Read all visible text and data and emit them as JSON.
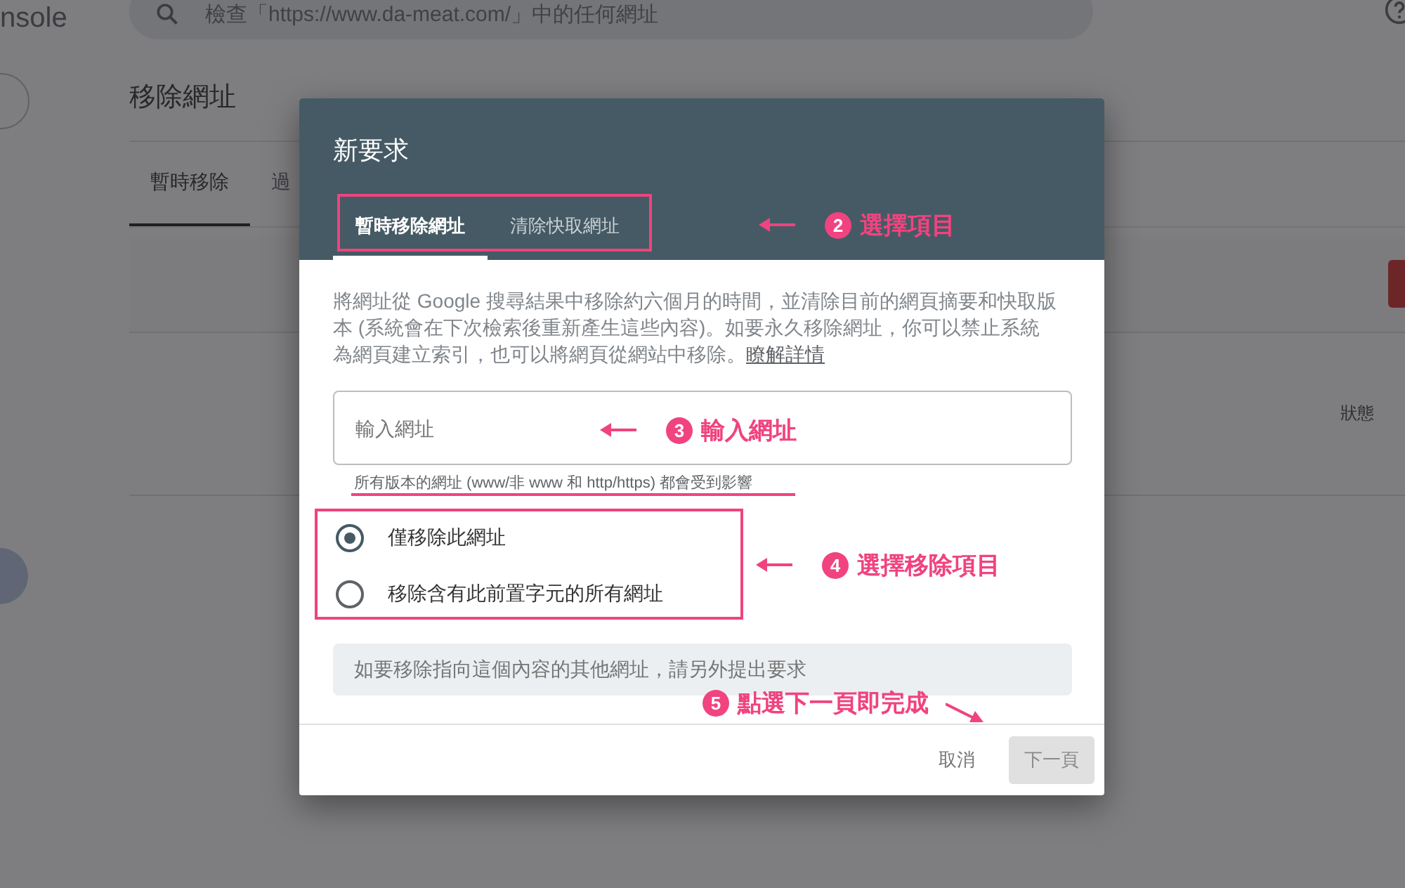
{
  "app": {
    "brand": "nsole",
    "search": {
      "placeholder": "檢查「https://www.da-meat.com/」中的任何網址"
    }
  },
  "page": {
    "title": "移除網址",
    "tabs": [
      {
        "label": "暫時移除",
        "selected": true
      },
      {
        "label": "過",
        "selected": false
      }
    ],
    "table_header": "狀態"
  },
  "dialog": {
    "title": "新要求",
    "tabs": [
      {
        "label": "暫時移除網址",
        "selected": true
      },
      {
        "label": "清除快取網址",
        "selected": false
      }
    ],
    "description": "將網址從 Google 搜尋結果中移除約六個月的時間，並清除目前的網頁摘要和快取版本 (系統會在下次檢索後重新產生這些內容)。如要永久移除網址，你可以禁止系統為網頁建立索引，也可以將網頁從網站中移除。",
    "learn_more": "瞭解詳情",
    "url_field": {
      "placeholder": "輸入網址"
    },
    "helper": "所有版本的網址 (www/非 www 和 http/https) 都會受到影響",
    "options": [
      {
        "label": "僅移除此網址",
        "selected": true
      },
      {
        "label": "移除含有此前置字元的所有網址",
        "selected": false
      }
    ],
    "notice": "如要移除指向這個內容的其他網址，請另外提出要求",
    "buttons": [
      {
        "label": "取消",
        "kind": "text",
        "disabled": false
      },
      {
        "label": "下一頁",
        "kind": "filled",
        "disabled": true
      }
    ]
  },
  "annotations": [
    {
      "number": "2",
      "text": "選擇項目",
      "kind": "arrow-before"
    },
    {
      "number": "3",
      "text": "輸入網址",
      "kind": "arrow-before"
    },
    {
      "number": "4",
      "text": "選擇移除項目",
      "kind": "arrow-before"
    },
    {
      "number": "5",
      "text": "點選下一頁即完成",
      "kind": "arrow-after"
    }
  ]
}
